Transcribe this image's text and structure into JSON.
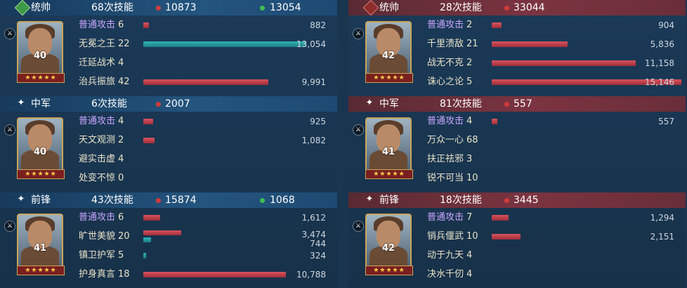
{
  "left": {
    "sections": [
      {
        "position": "统帅",
        "skill_count": "68次技能",
        "damage": "10873",
        "heal": "13054",
        "level": "40",
        "stars": "★★★★★",
        "skills": [
          {
            "name": "普通攻击",
            "count": "6",
            "basic": true,
            "bars": [
              {
                "value": "882",
                "fraction": 0.03,
                "kind": "dmg"
              }
            ]
          },
          {
            "name": "无冕之王",
            "count": "22",
            "basic": false,
            "bars": [
              {
                "value": "13,054",
                "fraction": 0.86,
                "kind": "heal"
              }
            ]
          },
          {
            "name": "迁延战术",
            "count": "4",
            "basic": false,
            "bars": []
          },
          {
            "name": "治兵振旅",
            "count": "42",
            "basic": false,
            "bars": [
              {
                "value": "9,991",
                "fraction": 0.66,
                "kind": "dmg"
              }
            ]
          }
        ]
      },
      {
        "position": "中军",
        "skill_count": "6次技能",
        "damage": "2007",
        "heal": "",
        "level": "40",
        "stars": "★★★★★",
        "skills": [
          {
            "name": "普通攻击",
            "count": "4",
            "basic": true,
            "bars": [
              {
                "value": "925",
                "fraction": 0.05,
                "kind": "dmg"
              }
            ]
          },
          {
            "name": "天文观测",
            "count": "2",
            "basic": false,
            "bars": [
              {
                "value": "1,082",
                "fraction": 0.06,
                "kind": "dmg"
              }
            ]
          },
          {
            "name": "避实击虚",
            "count": "4",
            "basic": false,
            "bars": []
          },
          {
            "name": "处变不惊",
            "count": "0",
            "basic": false,
            "bars": []
          }
        ]
      },
      {
        "position": "前锋",
        "skill_count": "43次技能",
        "damage": "15874",
        "heal": "1068",
        "level": "41",
        "stars": "★★★★★",
        "skills": [
          {
            "name": "普通攻击",
            "count": "6",
            "basic": true,
            "bars": [
              {
                "value": "1,612",
                "fraction": 0.09,
                "kind": "dmg"
              }
            ]
          },
          {
            "name": "旷世美貌",
            "count": "20",
            "basic": false,
            "bars": [
              {
                "value": "3,474",
                "fraction": 0.2,
                "kind": "dmg"
              },
              {
                "value": "744",
                "fraction": 0.04,
                "kind": "heal"
              }
            ]
          },
          {
            "name": "镇卫护军",
            "count": "5",
            "basic": false,
            "bars": [
              {
                "value": "324",
                "fraction": 0.015,
                "kind": "heal"
              }
            ]
          },
          {
            "name": "护身真言",
            "count": "18",
            "basic": false,
            "bars": [
              {
                "value": "10,788",
                "fraction": 0.75,
                "kind": "dmg"
              }
            ]
          }
        ]
      }
    ]
  },
  "right": {
    "sections": [
      {
        "position": "统帅",
        "skill_count": "28次技能",
        "damage": "33044",
        "heal": "",
        "level": "42",
        "stars": "★★★★★",
        "skills": [
          {
            "name": "普通攻击",
            "count": "2",
            "basic": true,
            "bars": [
              {
                "value": "904",
                "fraction": 0.05,
                "kind": "dmg"
              }
            ]
          },
          {
            "name": "千里溃敌",
            "count": "21",
            "basic": false,
            "bars": [
              {
                "value": "5,836",
                "fraction": 0.4,
                "kind": "dmg"
              }
            ]
          },
          {
            "name": "战无不克",
            "count": "2",
            "basic": false,
            "bars": [
              {
                "value": "11,158",
                "fraction": 0.76,
                "kind": "dmg"
              }
            ]
          },
          {
            "name": "诛心之论",
            "count": "5",
            "basic": false,
            "bars": [
              {
                "value": "15,146",
                "fraction": 1.0,
                "kind": "dmg"
              }
            ]
          }
        ]
      },
      {
        "position": "中军",
        "skill_count": "81次技能",
        "damage": "557",
        "heal": "",
        "level": "41",
        "stars": "★★★★★",
        "skills": [
          {
            "name": "普通攻击",
            "count": "4",
            "basic": true,
            "bars": [
              {
                "value": "557",
                "fraction": 0.03,
                "kind": "dmg"
              }
            ]
          },
          {
            "name": "万众一心",
            "count": "68",
            "basic": false,
            "bars": []
          },
          {
            "name": "扶正祛邪",
            "count": "3",
            "basic": false,
            "bars": []
          },
          {
            "name": "锐不可当",
            "count": "10",
            "basic": false,
            "bars": []
          }
        ]
      },
      {
        "position": "前锋",
        "skill_count": "18次技能",
        "damage": "3445",
        "heal": "",
        "level": "42",
        "stars": "★★★★★",
        "skills": [
          {
            "name": "普通攻击",
            "count": "7",
            "basic": true,
            "bars": [
              {
                "value": "1,294",
                "fraction": 0.09,
                "kind": "dmg"
              }
            ]
          },
          {
            "name": "销兵偃武",
            "count": "10",
            "basic": false,
            "bars": [
              {
                "value": "2,151",
                "fraction": 0.15,
                "kind": "dmg"
              }
            ]
          },
          {
            "name": "动于九天",
            "count": "4",
            "basic": false,
            "bars": []
          },
          {
            "name": "决水千仞",
            "count": "4",
            "basic": false,
            "bars": []
          }
        ]
      }
    ]
  },
  "colors": {
    "damage": "#d23b3b",
    "heal": "#3cbf55",
    "heal_bar": "#2fb4b8"
  }
}
